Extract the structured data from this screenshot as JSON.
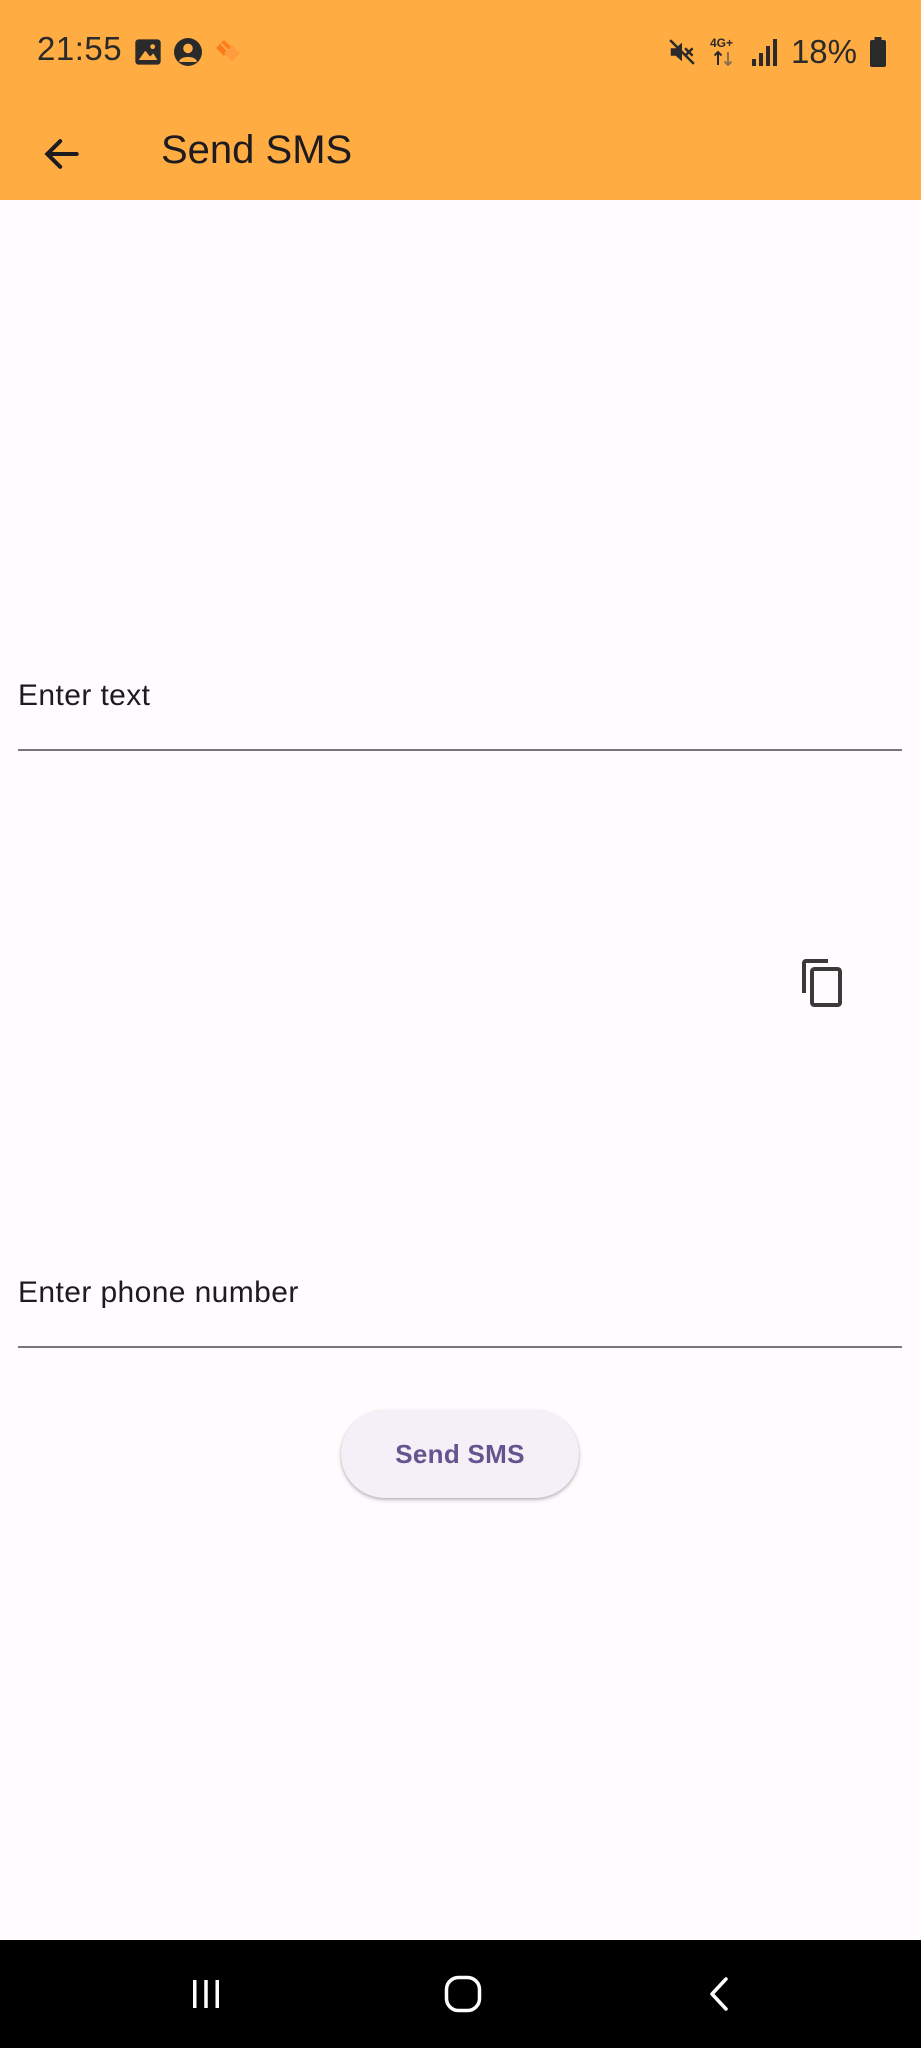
{
  "status_bar": {
    "time": "21:55",
    "battery_percent": "18%",
    "network_type": "4G+",
    "left_icons": [
      "image-icon",
      "account-circle-icon",
      "app-notification-icon"
    ],
    "right_icons": [
      "mute-icon",
      "network-4g-icon",
      "signal-icon",
      "battery-icon"
    ]
  },
  "app_bar": {
    "title": "Send SMS",
    "back_icon": "arrow-back-icon",
    "background_color": "#ffad42"
  },
  "form": {
    "text_field": {
      "label": "Enter text",
      "value": ""
    },
    "copy_icon": "copy-icon",
    "phone_field": {
      "label": "Enter phone number",
      "value": ""
    },
    "send_button_label": "Send SMS",
    "accent_color": "#65558f"
  },
  "nav_bar": {
    "buttons": [
      "recent-apps-icon",
      "home-icon",
      "back-icon"
    ]
  }
}
